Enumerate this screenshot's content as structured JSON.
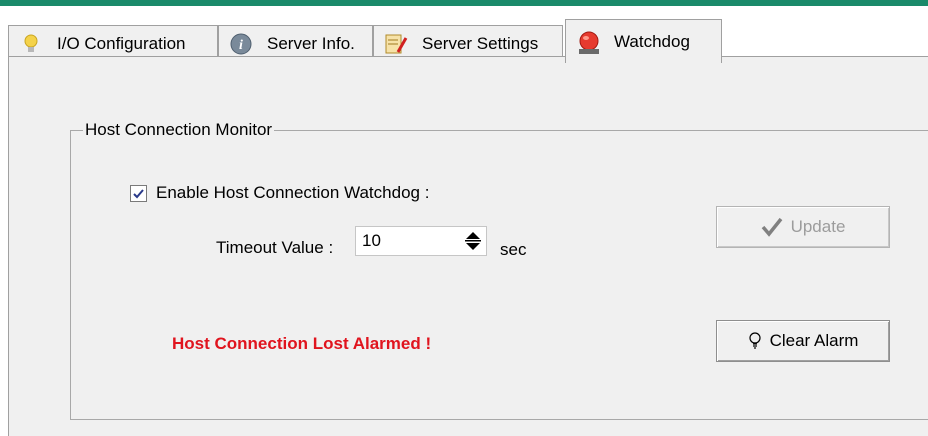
{
  "tabs": [
    {
      "label": "I/O Configuration",
      "icon": "lightbulb-icon"
    },
    {
      "label": "Server Info.",
      "icon": "info-icon"
    },
    {
      "label": "Server Settings",
      "icon": "settings-icon"
    },
    {
      "label": "Watchdog",
      "icon": "alarm-light-icon",
      "active": true
    }
  ],
  "group": {
    "title": "Host Connection Monitor",
    "enable_label": "Enable Host Connection Watchdog :",
    "enable_checked": true,
    "timeout_label": "Timeout Value :",
    "timeout_value": "10",
    "timeout_unit": "sec",
    "alarm_text": "Host Connection Lost Alarmed !",
    "update_label": "Update",
    "clear_label": "Clear Alarm"
  },
  "colors": {
    "accent_bar": "#1a8a6a",
    "alarm": "#e0141e"
  }
}
